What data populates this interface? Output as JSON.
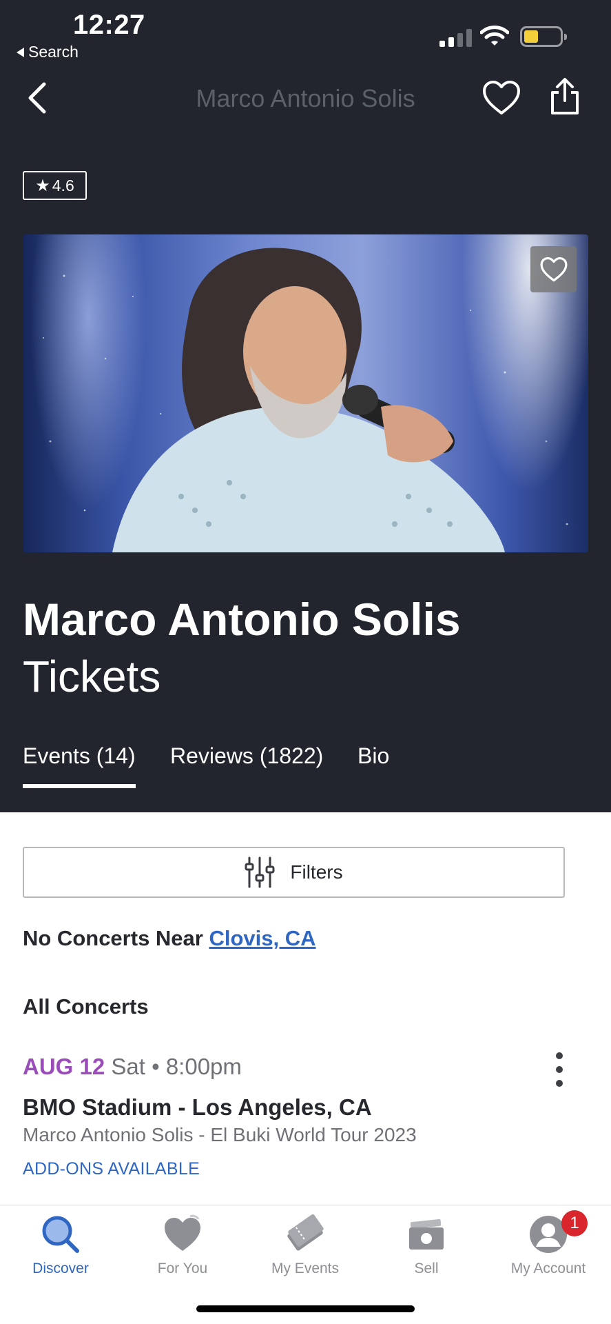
{
  "status_bar": {
    "time": "12:27",
    "back_label": "Search"
  },
  "nav": {
    "title": "Marco Antonio Solis"
  },
  "rating": {
    "star": "★",
    "value": "4.6"
  },
  "artist": {
    "name": "Marco Antonio Solis",
    "subtitle": "Tickets"
  },
  "tabs": [
    {
      "label": "Events (14)",
      "active": true
    },
    {
      "label": "Reviews (1822)",
      "active": false
    },
    {
      "label": "Bio",
      "active": false
    }
  ],
  "filters": {
    "label": "Filters"
  },
  "location": {
    "prefix": "No Concerts Near ",
    "city": "Clovis, CA"
  },
  "section_title": "All Concerts",
  "events": [
    {
      "month_day": "AUG 12",
      "day_time": "Sat • 8:00pm",
      "venue": "BMO Stadium - Los Angeles, CA",
      "tour": "Marco Antonio Solis - El Buki World Tour 2023",
      "addons": "ADD-ONS AVAILABLE"
    }
  ],
  "bottom_tabs": [
    {
      "label": "Discover",
      "icon": "discover-icon",
      "active": true
    },
    {
      "label": "For You",
      "icon": "heart-icon",
      "active": false
    },
    {
      "label": "My Events",
      "icon": "tickets-icon",
      "active": false
    },
    {
      "label": "Sell",
      "icon": "sell-icon",
      "active": false
    },
    {
      "label": "My Account",
      "icon": "account-icon",
      "active": false
    }
  ],
  "account_badge": "1",
  "colors": {
    "header_bg": "#22252d",
    "accent_blue": "#2f66c2",
    "date_purple": "#9a4db8",
    "badge_red": "#d8262c",
    "battery_yellow": "#f2cf3a"
  }
}
